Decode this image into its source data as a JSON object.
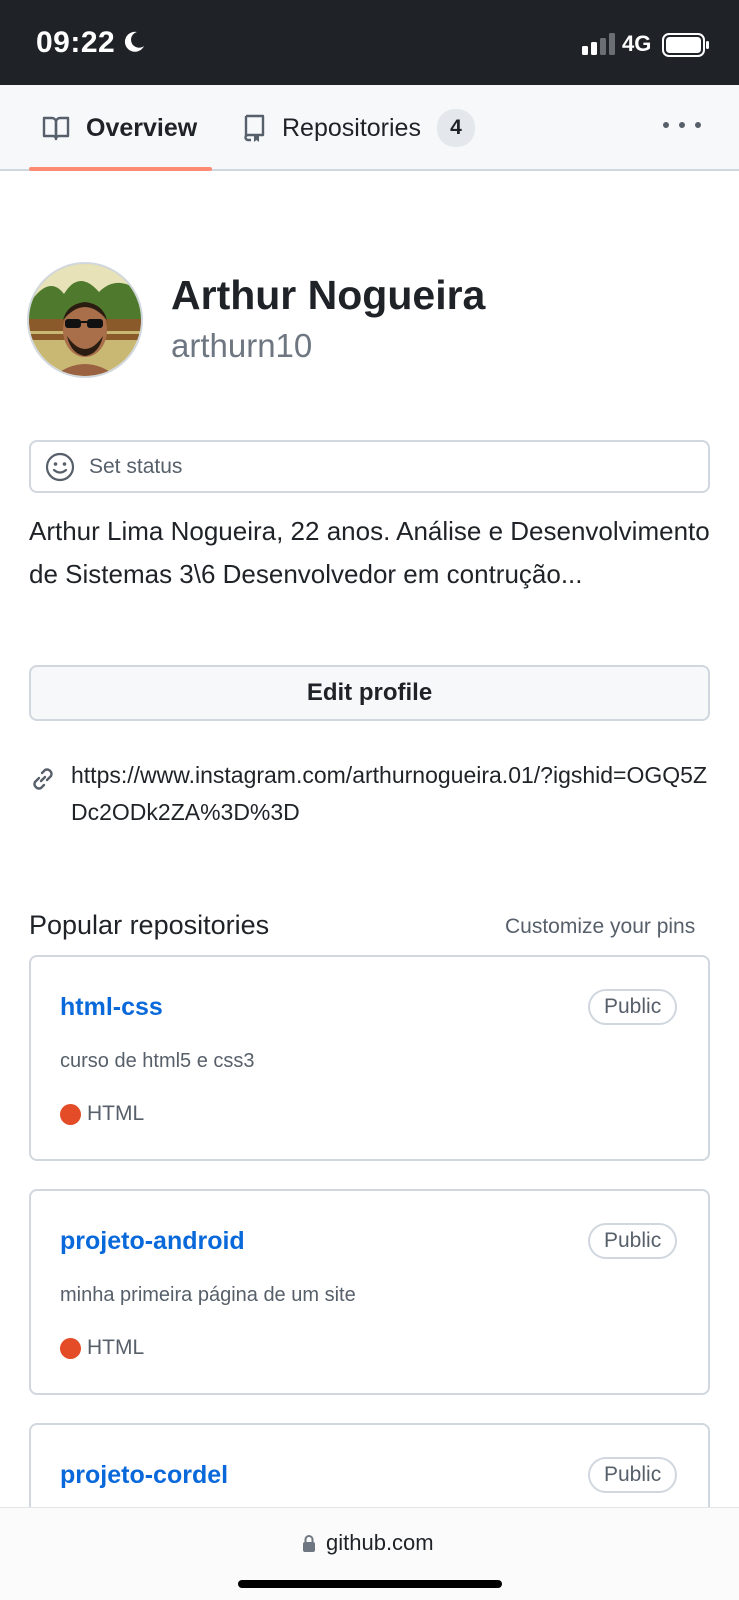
{
  "status_bar": {
    "time": "09:22",
    "network": "4G",
    "icons": [
      "moon-icon",
      "signal-icon",
      "battery-icon"
    ]
  },
  "tabs": {
    "overview_label": "Overview",
    "repositories_label": "Repositories",
    "repositories_count": "4",
    "active": "Overview",
    "more_icon": "kebab-horizontal-icon"
  },
  "profile": {
    "name": "Arthur Nogueira",
    "login": "arthurn10",
    "status_label": "Set status",
    "bio": "Arthur Lima Nogueira, 22 anos. Análise e Desenvolvimento de Sistemas 3\\6 Desenvolvedor em contrução...",
    "edit_label": "Edit profile",
    "link": "https://www.instagram.com/arthurnogueira.01/?igshid=OGQ5ZDc2ODk2ZA%3D%3D"
  },
  "popular": {
    "title": "Popular repositories",
    "customize_label": "Customize your pins",
    "repos": [
      {
        "name": "html-css",
        "visibility": "Public",
        "description": "curso de html5 e css3",
        "language": "HTML"
      },
      {
        "name": "projeto-android",
        "visibility": "Public",
        "description": "minha primeira página de um site",
        "language": "HTML"
      },
      {
        "name": "projeto-cordel",
        "visibility": "Public",
        "description": "",
        "language": ""
      }
    ]
  },
  "browser": {
    "url": "github.com"
  },
  "colors": {
    "status_bar": "#1f2328",
    "tab_underline": "#fd8c73",
    "link": "#0969da",
    "html_language": "#e34c26"
  }
}
